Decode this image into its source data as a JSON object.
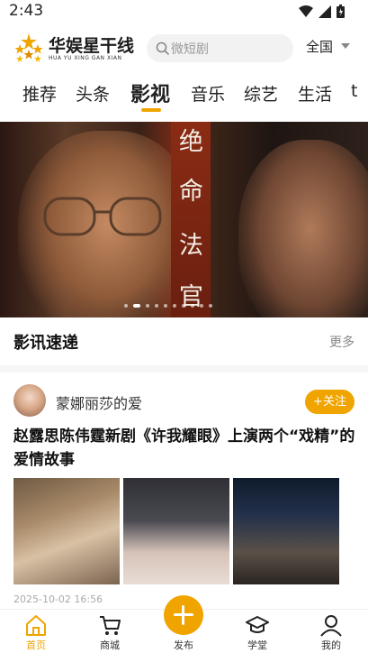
{
  "status_bar": {
    "time": "2:43"
  },
  "header": {
    "logo_text": "华娱星干线",
    "logo_sub": "HUA YU XING GAN XIAN",
    "search_placeholder": "微短剧",
    "region": "全国"
  },
  "tabs": [
    "推荐",
    "头条",
    "影视",
    "音乐",
    "综艺",
    "生活",
    "t"
  ],
  "active_tab": "影视",
  "banner": {
    "title_chars": [
      "绝",
      "命",
      "法",
      "官"
    ],
    "dot_count": 10,
    "active_dot": 1
  },
  "news_section": {
    "title": "影讯速递",
    "more": "更多"
  },
  "article": {
    "author": "蒙娜丽莎的爱",
    "follow_label": "+关注",
    "headline": "赵露思陈伟霆新剧《许我耀眼》上演两个“戏精”的爱情故事",
    "date": "2025-10-02 16:56"
  },
  "bottom_nav": {
    "items": [
      {
        "label": "首页",
        "icon": "home-icon",
        "active": true
      },
      {
        "label": "商城",
        "icon": "cart-icon",
        "active": false
      },
      {
        "label": "发布",
        "icon": "plus-icon",
        "active": false
      },
      {
        "label": "学堂",
        "icon": "graduation-cap-icon",
        "active": false
      },
      {
        "label": "我的",
        "icon": "user-icon",
        "active": false
      }
    ]
  },
  "colors": {
    "accent": "#f0a400"
  }
}
